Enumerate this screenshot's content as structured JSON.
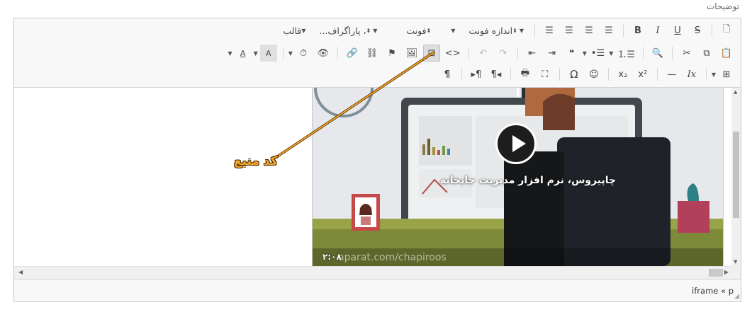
{
  "field_label": "توضیحات",
  "toolbar": {
    "row1": {
      "new_page": "🗋",
      "strike": "S",
      "underline": "U",
      "italic": "I",
      "bold": "B",
      "justify": "☰",
      "align_right": "☰",
      "center": "☰",
      "align_left": "☰",
      "font_size_label": "اندازه فونت",
      "font_label": "فونت",
      "paragraph_label": "، پاراگراف...",
      "template_label": "قالب"
    },
    "row2": {
      "paste": "📋",
      "copy": "⧉",
      "cut": "✂",
      "find": "🔍",
      "numbered_list": "⒈☰",
      "bullet_list": "•☰",
      "blockquote": "❝",
      "indent": "⇥",
      "outdent": "⇤",
      "redo": "↷",
      "undo": "↶",
      "source": "<>",
      "iframe": "⊡",
      "image": "🖼",
      "anchor": "⚑",
      "unlink": "⛓",
      "link": "🔗",
      "preview": "👁",
      "time": "⏱",
      "bg_color": "A",
      "text_color": "A"
    },
    "row3": {
      "table": "⊞",
      "remove_format": "Ix",
      "hr": "—",
      "superscript": "x²",
      "subscript": "x₂",
      "smiley": "☺",
      "special_char": "Ω",
      "maximize": "⛶",
      "print": "🖶",
      "rtl": "¶◂",
      "ltr": "▸¶",
      "show_blocks": "¶"
    }
  },
  "video": {
    "caption": "چاپیروس، نرم افزار مدیریت چاپخانه",
    "duration": "۲:۰۸",
    "watermark": "aparat.com/chapiroos"
  },
  "annotation": {
    "label": "کد منبع"
  },
  "status": {
    "path": "iframe « p"
  }
}
